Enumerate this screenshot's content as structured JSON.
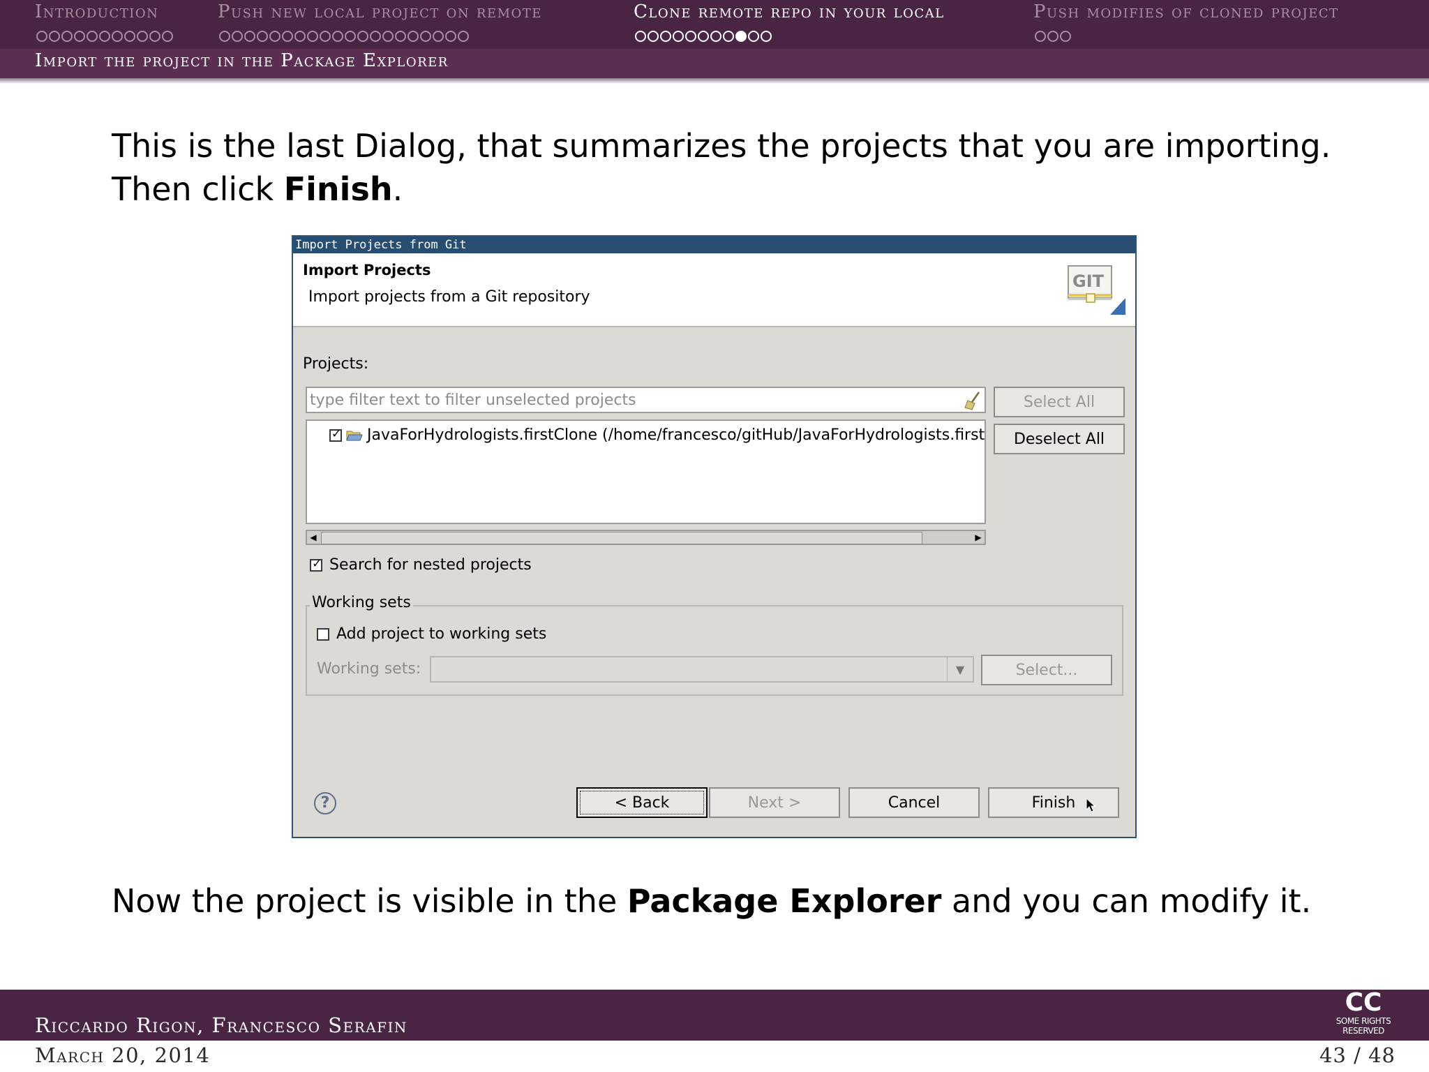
{
  "nav": {
    "sections": [
      {
        "label": "Introduction",
        "dots": 11,
        "filled_index": -1,
        "active": false
      },
      {
        "label": "Push new local project on remote",
        "dots": 20,
        "filled_index": -1,
        "active": false
      },
      {
        "label": "Clone remote repo in your local",
        "dots": 11,
        "filled_index": 8,
        "active": true
      },
      {
        "label": "Push modifies of cloned project",
        "dots": 3,
        "filled_index": -1,
        "active": false
      }
    ],
    "subsection": "Import the project in the Package Explorer"
  },
  "intro": {
    "line1": "This is the last Dialog, that summarizes the projects that you are importing.",
    "line2_pre": "Then click ",
    "line2_bold": "Finish",
    "line2_post": "."
  },
  "dialog": {
    "title": "Import Projects from Git",
    "banner_title": "Import Projects",
    "banner_subtitle": "Import projects from a Git repository",
    "logo_text": "GIT",
    "projects_label": "Projects:",
    "filter_placeholder": "type filter text to filter unselected projects",
    "select_all": "Select All",
    "deselect_all": "Deselect All",
    "project_item": "JavaForHydrologists.firstClone (/home/francesco/gitHub/JavaForHydrologists.first",
    "project_checked": true,
    "search_nested_label": "Search for nested projects",
    "search_nested_checked": true,
    "working_sets_group": "Working sets",
    "add_to_working_sets_label": "Add project to working sets",
    "add_to_working_sets_checked": false,
    "working_sets_label": "Working sets:",
    "working_sets_value": "",
    "select_button": "Select...",
    "back_button": "< Back",
    "next_button": "Next >",
    "cancel_button": "Cancel",
    "finish_button": "Finish"
  },
  "outro": {
    "pre": "Now the project is visible in the ",
    "bold": "Package Explorer",
    "post": " and you can modify it."
  },
  "footer": {
    "authors": "Riccardo Rigon, Francesco Serafin",
    "date": "March 20, 2014",
    "page": "43 / 48",
    "license_mark": "CC",
    "license_text": "SOME RIGHTS RESERVED"
  },
  "colors": {
    "header_bg": "#492443",
    "inactive_nav": "#a6909f",
    "dialog_titlebar": "#284d73"
  }
}
